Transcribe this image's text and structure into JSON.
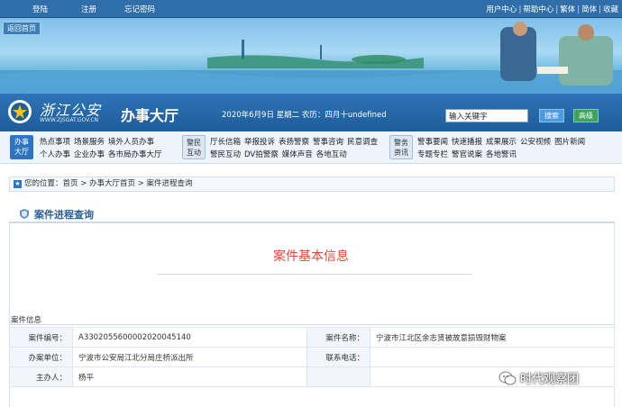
{
  "topbar": {
    "login": "登陆",
    "register": "注册",
    "forgot": "忘记密码",
    "links": [
      "用户中心",
      "帮助中心",
      "繁体",
      "简体",
      "收藏"
    ]
  },
  "banner": {
    "back": "返回首页"
  },
  "header": {
    "logo_text": "浙江公安",
    "logo_url": "WWW.ZJSGAT.GOV.CN",
    "hall": "办事大厅",
    "date": "2020年6月9日 星期二 农历：四月十undefined",
    "search_value": "输入关键字",
    "search_btn": "搜索",
    "advanced_btn": "高级"
  },
  "nav": {
    "badge1": [
      "办事",
      "大厅"
    ],
    "group1_row1": [
      "热点事项",
      "场景服务",
      "境外人员办事"
    ],
    "group1_row2": [
      "个人办事",
      "企业办事",
      "各市局办事大厅"
    ],
    "badge2": [
      "警民",
      "互动"
    ],
    "group2_row1": [
      "厅长信箱",
      "举报投诉",
      "表扬警察",
      "警事咨询",
      "民意调查"
    ],
    "group2_row2": [
      "警民互动",
      "DV拍警察",
      "媒体声音",
      "各地互动"
    ],
    "badge3": [
      "警务",
      "资讯"
    ],
    "group3_row1": [
      "警事要闻",
      "快速播报",
      "成果展示",
      "公安视频",
      "图片新闻"
    ],
    "group3_row2": [
      "专题专栏",
      "警官说案",
      "各地警讯"
    ]
  },
  "breadcrumb": {
    "text": "您的位置：首页 > 办事大厅首页 > 案件进程查询"
  },
  "panel": {
    "title": "案件进程查询"
  },
  "case": {
    "heading": "案件基本信息",
    "section": "案件信息",
    "rows": [
      {
        "k1": "案件编号：",
        "v1": "A3302055600002020045140",
        "k2": "案件名称：",
        "v2": "宁波市江北区余志贤被故意损毁财物案"
      },
      {
        "k1": "办案单位：",
        "v1": "宁波市公安局江北分局庄桥派出所",
        "k2": "联系电话：",
        "v2": ""
      },
      {
        "k1": "主办人：",
        "v1": "杨平",
        "k2": "",
        "v2": ""
      }
    ]
  },
  "watermark": "时代观察团"
}
